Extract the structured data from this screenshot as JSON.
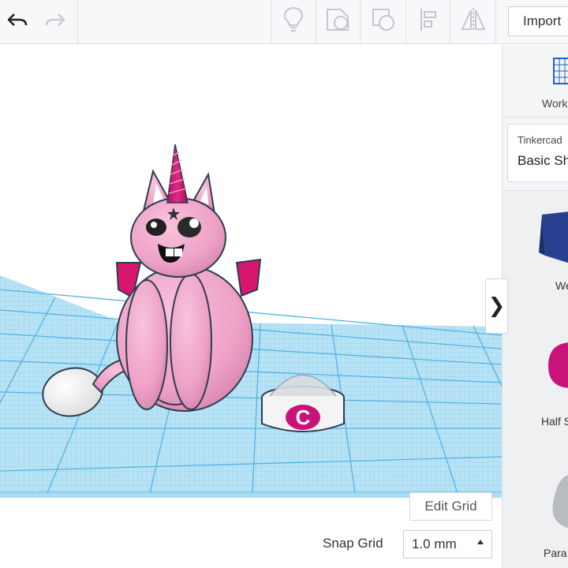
{
  "toolbar": {
    "undo_icon": "undo-arrow-icon",
    "redo_icon": "redo-arrow-icon",
    "tools": [
      "lightbulb-icon",
      "note-shape-icon",
      "hole-shape-icon",
      "align-icon",
      "mirror-icon"
    ],
    "import_label": "Import"
  },
  "panel": {
    "workplane_label": "Work",
    "library_provider": "Tinkercad",
    "library_name": "Basic Sh",
    "shapes": [
      {
        "label": "We",
        "icon": "wedge-shape-icon",
        "color": "#27408f"
      },
      {
        "label": "Half S",
        "icon": "half-sphere-shape-icon",
        "color": "#c8147a"
      },
      {
        "label": "Para",
        "icon": "paraboloid-shape-icon",
        "color": "#b9bcbf"
      }
    ],
    "collapse_glyph": "❯"
  },
  "bottom": {
    "edit_grid_label": "Edit Grid",
    "snap_grid_label": "Snap Grid",
    "snap_grid_value": "1.0 mm"
  },
  "scene": {
    "grid_color": "#5bb9e8",
    "grid_fill": "#bfe6f6",
    "cat_color": "#f3a6cc",
    "accent_color": "#d6166f",
    "bowl_letter": "C"
  }
}
